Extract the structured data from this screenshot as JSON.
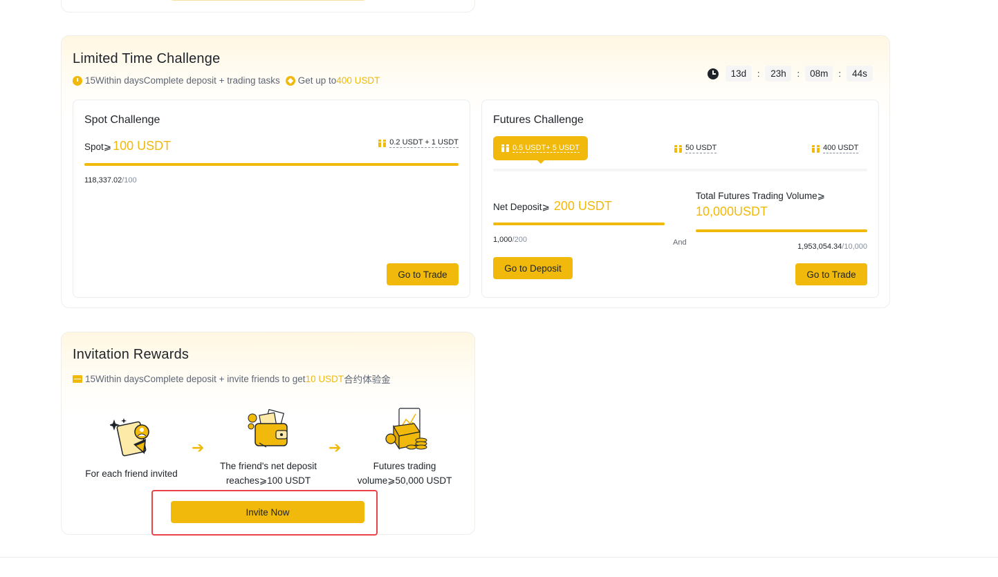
{
  "limited_challenge": {
    "title": "Limited Time Challenge",
    "subtitle_a": "15Within daysComplete deposit + trading tasks",
    "subtitle_b": "Get up to",
    "subtitle_b_highlight": "400 USDT",
    "timer": {
      "days": "13d",
      "hours": "23h",
      "minutes": "08m",
      "seconds": "44s",
      "separator": ":"
    }
  },
  "spot": {
    "title": "Spot Challenge",
    "req_label": "Spot⩾",
    "req_value": "100 USDT",
    "reward": "0.2 USDT + 1 USDT",
    "progress_current": "118,337.02",
    "progress_target": "/100",
    "progress_fraction": 1.0,
    "button": "Go to Trade"
  },
  "futures": {
    "title": "Futures Challenge",
    "tiers": [
      "0.5 USDT+ 5 USDT",
      "50 USDT",
      "400 USDT"
    ],
    "active_tier": 0,
    "deposit_label": "Net Deposit⩾",
    "deposit_value": "200 USDT",
    "deposit_current": "1,000",
    "deposit_target": "/200",
    "deposit_fraction": 1.0,
    "deposit_button": "Go to Deposit",
    "and_label": "And",
    "volume_label": "Total Futures Trading Volume⩾",
    "volume_value": "10,000USDT",
    "volume_current": "1,953,054.34",
    "volume_target": "/10,000",
    "volume_fraction": 1.0,
    "trade_button": "Go to Trade"
  },
  "invitation": {
    "title": "Invitation Rewards",
    "subtitle_a": "15Within daysComplete deposit + invite friends to get",
    "subtitle_highlight": "10 USDT",
    "subtitle_cn": "合约体验金",
    "steps": [
      {
        "line1": "For each friend invited",
        "line2": ""
      },
      {
        "line1": "The friend's net deposit",
        "line2": "reaches⩾100 USDT"
      },
      {
        "line1": "Futures trading",
        "line2": "volume⩾50,000 USDT"
      }
    ],
    "arrow": "➔",
    "button": "Invite Now"
  },
  "colors": {
    "accent": "#f0b90b",
    "text": "#1e2329",
    "muted": "#848e9c",
    "highlight_border": "#e8424a"
  }
}
